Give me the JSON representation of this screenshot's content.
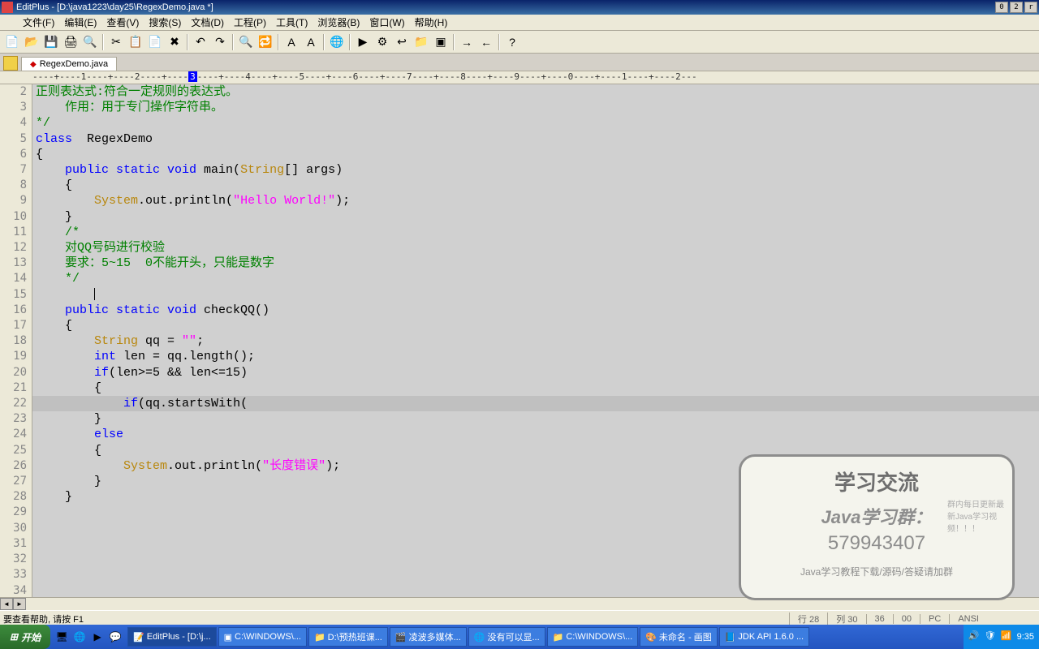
{
  "title_bar": {
    "app": "EditPlus",
    "document": "[D:\\java1223\\day25\\RegexDemo.java *]"
  },
  "menus": [
    "文件(F)",
    "编辑(E)",
    "查看(V)",
    "搜索(S)",
    "文档(D)",
    "工程(P)",
    "工具(T)",
    "浏览器(B)",
    "窗口(W)",
    "帮助(H)"
  ],
  "toolbar_icons": [
    "new-icon",
    "open-icon",
    "save-icon",
    "print-icon",
    "preview-icon",
    "sep",
    "cut-icon",
    "copy-icon",
    "paste-icon",
    "delete-icon",
    "sep",
    "undo-icon",
    "redo-icon",
    "sep",
    "find-icon",
    "replace-icon",
    "sep",
    "font-bold-icon",
    "font-italic-icon",
    "sep",
    "browser-icon",
    "sep",
    "run-icon",
    "compile-icon",
    "word-wrap-icon",
    "folder-icon",
    "terminal-icon",
    "sep",
    "indent-icon",
    "outdent-icon",
    "sep",
    "help-icon"
  ],
  "tab": {
    "name": "RegexDemo.java",
    "modified": true
  },
  "ruler_text": "----+----1----+----2----+----3----+----4----+----5----+----6----+----7----+----8----+----9----+----0----+----1----+----2---",
  "ruler_marker_at": "3",
  "code_lines": [
    {
      "n": 2,
      "seg": [
        {
          "c": "cmt",
          "t": "正则表达式:符合一定规则的表达式。"
        }
      ]
    },
    {
      "n": 3,
      "seg": [
        {
          "c": "cmt",
          "t": "    作用：用于专门操作字符串。"
        }
      ]
    },
    {
      "n": 4,
      "seg": []
    },
    {
      "n": 5,
      "seg": [
        {
          "c": "cmt",
          "t": "*/"
        }
      ]
    },
    {
      "n": 6,
      "seg": []
    },
    {
      "n": 7,
      "seg": [
        {
          "c": "kw",
          "t": "class"
        },
        {
          "c": "ident",
          "t": "  RegexDemo"
        }
      ]
    },
    {
      "n": 8,
      "seg": [
        {
          "c": "ident",
          "t": "{"
        }
      ]
    },
    {
      "n": 9,
      "seg": [
        {
          "c": "ident",
          "t": "    "
        },
        {
          "c": "kw",
          "t": "public static void"
        },
        {
          "c": "ident",
          "t": " main("
        },
        {
          "c": "type",
          "t": "String"
        },
        {
          "c": "ident",
          "t": "[] args)"
        }
      ]
    },
    {
      "n": 10,
      "seg": [
        {
          "c": "ident",
          "t": "    {"
        }
      ]
    },
    {
      "n": 11,
      "seg": [
        {
          "c": "ident",
          "t": "        "
        },
        {
          "c": "type",
          "t": "System"
        },
        {
          "c": "ident",
          "t": ".out.println("
        },
        {
          "c": "str",
          "t": "\"Hello World!\""
        },
        {
          "c": "ident",
          "t": ");"
        }
      ]
    },
    {
      "n": 12,
      "seg": [
        {
          "c": "ident",
          "t": "    }"
        }
      ]
    },
    {
      "n": 13,
      "seg": []
    },
    {
      "n": 14,
      "seg": [
        {
          "c": "cmt",
          "t": "    /*"
        }
      ]
    },
    {
      "n": 15,
      "seg": [
        {
          "c": "cmt",
          "t": "    对QQ号码进行校验"
        }
      ]
    },
    {
      "n": 16,
      "seg": [
        {
          "c": "cmt",
          "t": "    要求：5~15  0不能开头，只能是数字"
        }
      ]
    },
    {
      "n": 17,
      "seg": []
    },
    {
      "n": 18,
      "seg": [
        {
          "c": "cmt",
          "t": "    */"
        }
      ]
    },
    {
      "n": 19,
      "seg": [
        {
          "c": "ident",
          "t": "        "
        }
      ],
      "caret": true
    },
    {
      "n": 20,
      "seg": [
        {
          "c": "ident",
          "t": "    "
        },
        {
          "c": "kw",
          "t": "public static void"
        },
        {
          "c": "ident",
          "t": " checkQQ()"
        }
      ]
    },
    {
      "n": 21,
      "seg": [
        {
          "c": "ident",
          "t": "    {"
        }
      ]
    },
    {
      "n": 22,
      "seg": [
        {
          "c": "ident",
          "t": "        "
        },
        {
          "c": "type",
          "t": "String"
        },
        {
          "c": "ident",
          "t": " qq = "
        },
        {
          "c": "str",
          "t": "\"\""
        },
        {
          "c": "ident",
          "t": ";"
        }
      ]
    },
    {
      "n": 23,
      "seg": []
    },
    {
      "n": 24,
      "seg": [
        {
          "c": "ident",
          "t": "        "
        },
        {
          "c": "kw",
          "t": "int"
        },
        {
          "c": "ident",
          "t": " len = qq.length();"
        }
      ]
    },
    {
      "n": 25,
      "seg": []
    },
    {
      "n": 26,
      "seg": [
        {
          "c": "ident",
          "t": "        "
        },
        {
          "c": "kw",
          "t": "if"
        },
        {
          "c": "ident",
          "t": "(len>=5 && len<=15)"
        }
      ]
    },
    {
      "n": 27,
      "seg": [
        {
          "c": "ident",
          "t": "        {"
        }
      ]
    },
    {
      "n": 28,
      "seg": [
        {
          "c": "ident",
          "t": "            "
        },
        {
          "c": "kw",
          "t": "if"
        },
        {
          "c": "ident",
          "t": "(qq.startsWith("
        }
      ],
      "current": true
    },
    {
      "n": 29,
      "seg": [
        {
          "c": "ident",
          "t": "        }"
        }
      ]
    },
    {
      "n": 30,
      "seg": [
        {
          "c": "ident",
          "t": "        "
        },
        {
          "c": "kw",
          "t": "else"
        }
      ]
    },
    {
      "n": 31,
      "seg": [
        {
          "c": "ident",
          "t": "        {"
        }
      ]
    },
    {
      "n": 32,
      "seg": [
        {
          "c": "ident",
          "t": "            "
        },
        {
          "c": "type",
          "t": "System"
        },
        {
          "c": "ident",
          "t": ".out.println("
        },
        {
          "c": "str",
          "t": "\"长度错误\""
        },
        {
          "c": "ident",
          "t": ");"
        }
      ]
    },
    {
      "n": 33,
      "seg": [
        {
          "c": "ident",
          "t": "        }"
        }
      ]
    },
    {
      "n": 34,
      "seg": [
        {
          "c": "ident",
          "t": "    }"
        }
      ]
    }
  ],
  "status": {
    "help": "要查看帮助, 请按 F1",
    "line_lbl": "行",
    "line": "28",
    "col_lbl": "列",
    "col": "30",
    "num1": "36",
    "num2": "00",
    "mode": "PC",
    "enc": "ANSI"
  },
  "taskbar": {
    "start": "开始",
    "tasks": [
      {
        "icon": "📝",
        "label": "EditPlus - [D:\\j...",
        "active": true
      },
      {
        "icon": "▣",
        "label": "C:\\WINDOWS\\..."
      },
      {
        "icon": "📁",
        "label": "D:\\预热班课..."
      },
      {
        "icon": "🎬",
        "label": "凌波多媒体..."
      },
      {
        "icon": "🌐",
        "label": "没有可以显..."
      },
      {
        "icon": "📁",
        "label": "C:\\WINDOWS\\..."
      },
      {
        "icon": "🎨",
        "label": "未命名 - 画图"
      },
      {
        "icon": "📘",
        "label": "JDK API 1.6.0 ..."
      }
    ],
    "time": "9:35"
  },
  "watermark": {
    "title": "学习交流",
    "sub": "Java学习群：",
    "num": "579943407",
    "foot": "Java学习教程下载/源码/答疑请加群",
    "note": "群内每日更新最新Java学习视频！！！"
  }
}
